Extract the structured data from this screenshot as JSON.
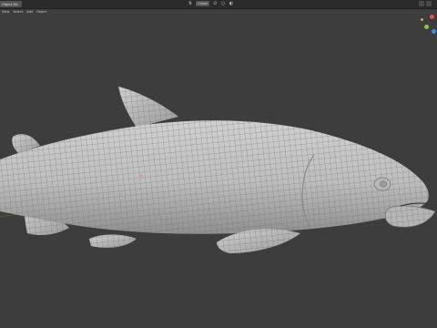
{
  "header": {
    "mode_label": "Object Mode",
    "mode_label_short": "Object Mo",
    "transform_orientation": "Global"
  },
  "menu": [
    "View",
    "Select",
    "Add",
    "Object"
  ],
  "colors": {
    "viewport_bg": "#3d3d3d",
    "header_bg": "#2b2b2b",
    "mesh_fill": "#bfbfbf",
    "wire": "#5d5d5d",
    "axis_x": "#e0515b",
    "axis_y": "#8bc34a",
    "axis_z": "#3f8be0"
  },
  "icons": [
    "transform-pivot-icon",
    "snap-icon",
    "proportional-edit-icon",
    "viewport-shading-icon",
    "navigation-gizmo-icon"
  ]
}
